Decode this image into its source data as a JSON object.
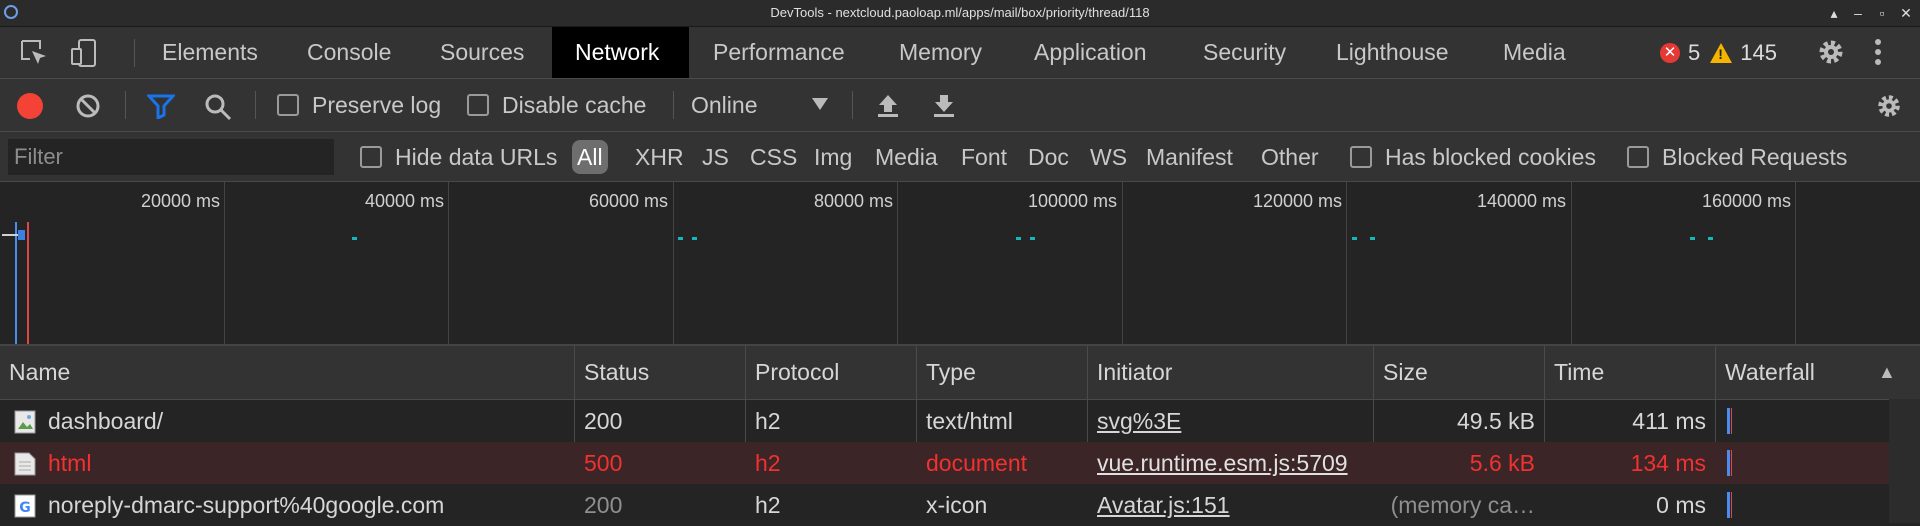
{
  "window": {
    "title": "DevTools - nextcloud.paoloap.ml/apps/mail/box/priority/thread/118"
  },
  "tabs": [
    {
      "label": "Elements"
    },
    {
      "label": "Console"
    },
    {
      "label": "Sources"
    },
    {
      "label": "Network"
    },
    {
      "label": "Performance"
    },
    {
      "label": "Memory"
    },
    {
      "label": "Application"
    },
    {
      "label": "Security"
    },
    {
      "label": "Lighthouse"
    },
    {
      "label": "Media"
    }
  ],
  "active_tab": "Network",
  "counts": {
    "errors": "5",
    "warnings": "145"
  },
  "toolbar": {
    "preserve_log": "Preserve log",
    "disable_cache": "Disable cache",
    "throttle": "Online"
  },
  "filterbar": {
    "placeholder": "Filter",
    "hide_data_urls": "Hide data URLs",
    "types": [
      "All",
      "XHR",
      "JS",
      "CSS",
      "Img",
      "Media",
      "Font",
      "Doc",
      "WS",
      "Manifest",
      "Other"
    ],
    "has_blocked_cookies": "Has blocked cookies",
    "blocked_requests": "Blocked Requests"
  },
  "overview": {
    "ticks": [
      "20000 ms",
      "40000 ms",
      "60000 ms",
      "80000 ms",
      "100000 ms",
      "120000 ms",
      "140000 ms",
      "160000 ms"
    ]
  },
  "columns": [
    "Name",
    "Status",
    "Protocol",
    "Type",
    "Initiator",
    "Size",
    "Time",
    "Waterfall"
  ],
  "sort_indicator": "▲",
  "rows": [
    {
      "name": "dashboard/",
      "status": "200",
      "protocol": "h2",
      "type": "text/html",
      "initiator": "svg%3E",
      "size": "49.5 kB",
      "time": "411 ms"
    },
    {
      "name": "html",
      "status": "500",
      "protocol": "h2",
      "type": "document",
      "initiator": "vue.runtime.esm.js:5709",
      "size": "5.6 kB",
      "time": "134 ms"
    },
    {
      "name": "noreply-dmarc-support%40google.com",
      "status": "200",
      "protocol": "h2",
      "type": "x-icon",
      "initiator": "Avatar.js:151",
      "size": "(memory ca…",
      "time": "0 ms"
    }
  ],
  "colors": {
    "record": "#f44336",
    "filter_active": "#1a73e8",
    "error_row_text": "#f23131",
    "dot": "#14b8b8"
  }
}
